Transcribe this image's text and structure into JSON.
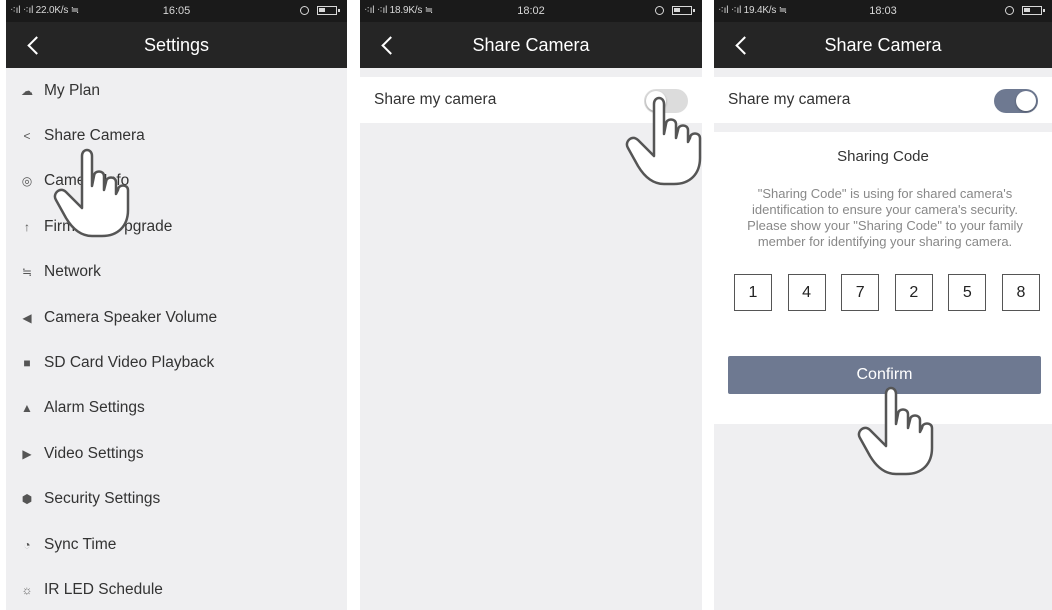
{
  "screen1": {
    "status": {
      "left": "⁖ıl ⁖ıl 22.0K/s ≒",
      "time": "16:05"
    },
    "title": "Settings",
    "menu": [
      {
        "icon": "cloud-icon",
        "glyph": "☁",
        "label": "My Plan"
      },
      {
        "icon": "share-icon",
        "glyph": "<",
        "label": "Share Camera"
      },
      {
        "icon": "camera-icon",
        "glyph": "◎",
        "label": "Camera Info"
      },
      {
        "icon": "upgrade-arrow-icon",
        "glyph": "↑",
        "label": "Firmware Upgrade"
      },
      {
        "icon": "wifi-icon",
        "glyph": "≒",
        "label": "Network"
      },
      {
        "icon": "speaker-icon",
        "glyph": "◀",
        "label": "Camera Speaker Volume"
      },
      {
        "icon": "sd-card-icon",
        "glyph": "■",
        "label": "SD Card Video Playback"
      },
      {
        "icon": "alarm-warning-icon",
        "glyph": "▲",
        "label": "Alarm Settings"
      },
      {
        "icon": "video-play-icon",
        "glyph": "▶",
        "label": "Video Settings"
      },
      {
        "icon": "shield-icon",
        "glyph": "⬢",
        "label": "Security Settings"
      },
      {
        "icon": "clock-icon",
        "glyph": "◔",
        "label": "Sync Time"
      },
      {
        "icon": "ir-led-icon",
        "glyph": "☼",
        "label": "IR LED Schedule"
      }
    ]
  },
  "screen2": {
    "status": {
      "left": "⁖ıl ⁖ıl 18.9K/s ≒",
      "time": "18:02"
    },
    "title": "Share Camera",
    "share_label": "Share my camera",
    "toggle_state": "off"
  },
  "screen3": {
    "status": {
      "left": "⁖ıl ⁖ıl 19.4K/s ≒",
      "time": "18:03"
    },
    "title": "Share Camera",
    "share_label": "Share my camera",
    "toggle_state": "on",
    "code_title": "Sharing Code",
    "code_description": "\"Sharing Code\" is using for shared camera's identification to ensure your camera's security. Please show your \"Sharing Code\" to your family member for identifying your sharing camera.",
    "digits": [
      "1",
      "4",
      "7",
      "2",
      "5",
      "8"
    ],
    "confirm_label": "Confirm"
  },
  "colors": {
    "navbar": "#252525",
    "statusbar": "#1a1a1a",
    "accent": "#6e7991",
    "background": "#efeff1"
  }
}
